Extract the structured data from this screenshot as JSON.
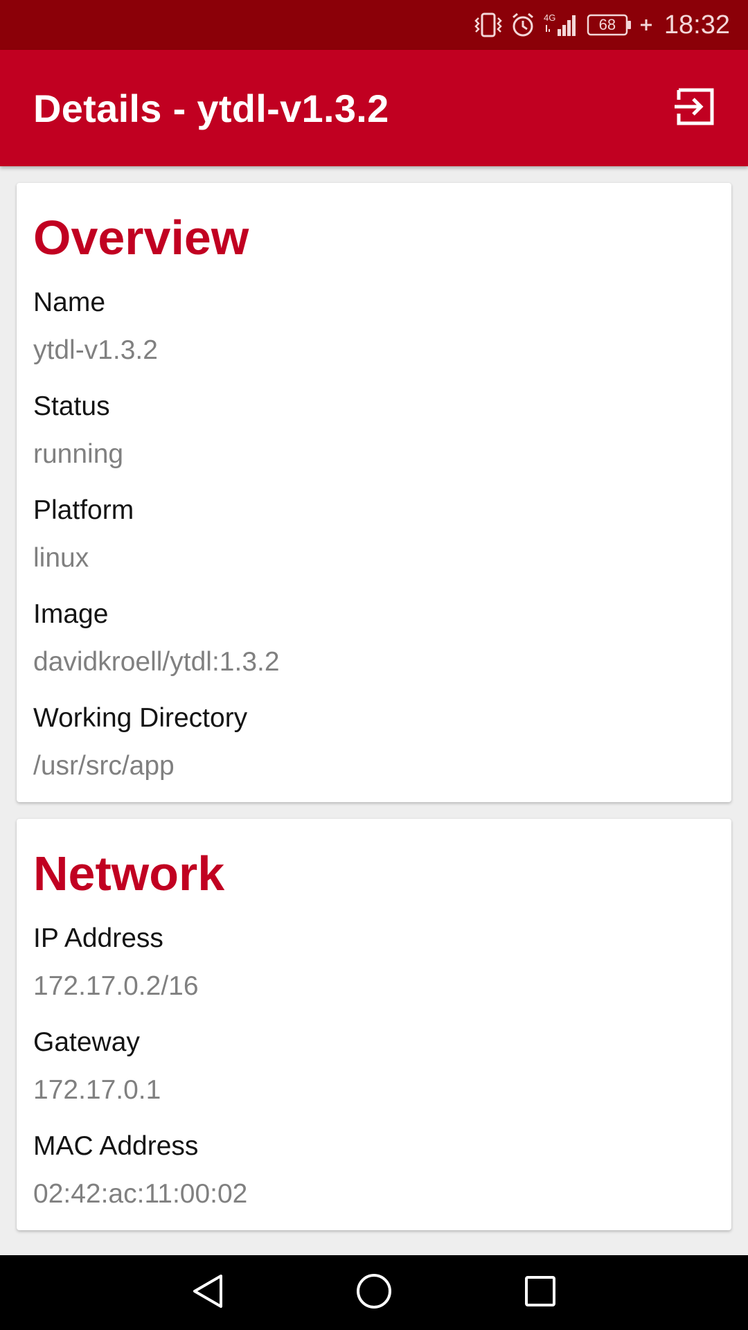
{
  "status_bar": {
    "battery_level": "68",
    "time": "18:32",
    "network_type": "4G",
    "icons": [
      "vibrate-icon",
      "alarm-icon",
      "signal-4g-icon",
      "battery-icon",
      "charging-icon"
    ]
  },
  "app_bar": {
    "title": "Details - ytdl-v1.3.2",
    "action_icon": "exit-to-app-icon"
  },
  "overview": {
    "title": "Overview",
    "fields": [
      {
        "label": "Name",
        "value": "ytdl-v1.3.2"
      },
      {
        "label": "Status",
        "value": "running"
      },
      {
        "label": "Platform",
        "value": "linux"
      },
      {
        "label": "Image",
        "value": "davidkroell/ytdl:1.3.2"
      },
      {
        "label": "Working Directory",
        "value": "/usr/src/app"
      }
    ]
  },
  "network": {
    "title": "Network",
    "fields": [
      {
        "label": "IP Address",
        "value": "172.17.0.2/16"
      },
      {
        "label": "Gateway",
        "value": "172.17.0.1"
      },
      {
        "label": "MAC Address",
        "value": "02:42:ac:11:00:02"
      }
    ]
  },
  "nav_bar": {
    "buttons": [
      "back-icon",
      "home-icon",
      "recents-icon"
    ]
  },
  "colors": {
    "status_bar": "#8b0008",
    "app_bar": "#c10021",
    "accent_title": "#c10021",
    "label_text": "#141414",
    "value_text": "#808080",
    "background": "#eeeeee"
  }
}
